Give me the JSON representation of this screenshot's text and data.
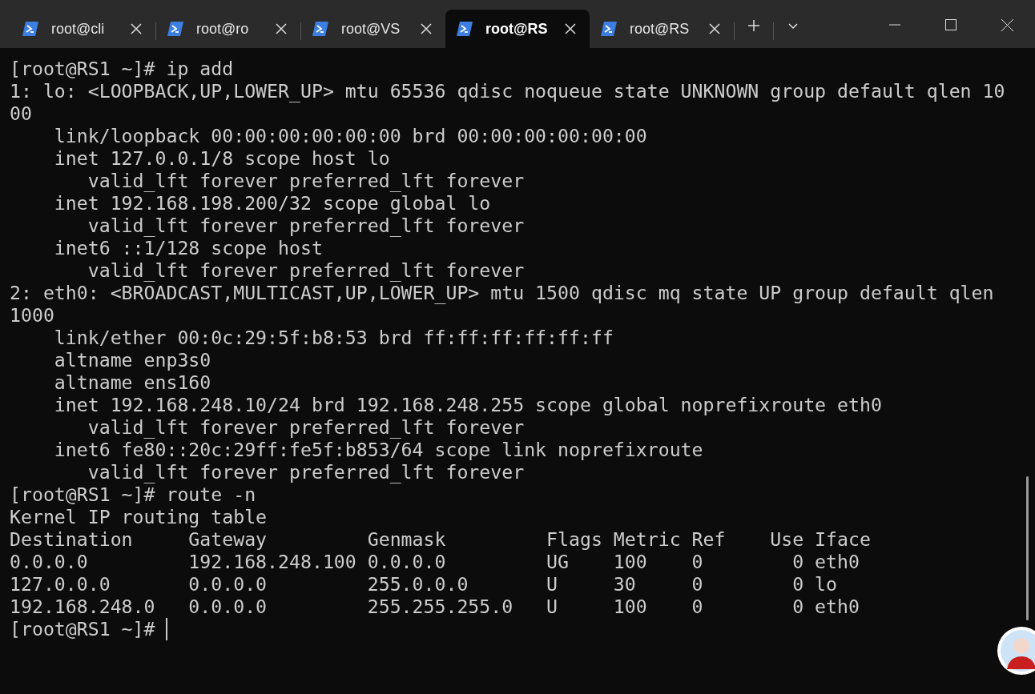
{
  "tabs": [
    {
      "label": "root@cli",
      "selected": false
    },
    {
      "label": "root@ro",
      "selected": false
    },
    {
      "label": "root@VS",
      "selected": false
    },
    {
      "label": "root@RS",
      "selected": true
    },
    {
      "label": "root@RS",
      "selected": false
    }
  ],
  "terminal": {
    "lines": [
      "[root@RS1 ~]# ip add",
      "1: lo: <LOOPBACK,UP,LOWER_UP> mtu 65536 qdisc noqueue state UNKNOWN group default qlen 10",
      "00",
      "    link/loopback 00:00:00:00:00:00 brd 00:00:00:00:00:00",
      "    inet 127.0.0.1/8 scope host lo",
      "       valid_lft forever preferred_lft forever",
      "    inet 192.168.198.200/32 scope global lo",
      "       valid_lft forever preferred_lft forever",
      "    inet6 ::1/128 scope host",
      "       valid_lft forever preferred_lft forever",
      "2: eth0: <BROADCAST,MULTICAST,UP,LOWER_UP> mtu 1500 qdisc mq state UP group default qlen",
      "1000",
      "    link/ether 00:0c:29:5f:b8:53 brd ff:ff:ff:ff:ff:ff",
      "    altname enp3s0",
      "    altname ens160",
      "    inet 192.168.248.10/24 brd 192.168.248.255 scope global noprefixroute eth0",
      "       valid_lft forever preferred_lft forever",
      "    inet6 fe80::20c:29ff:fe5f:b853/64 scope link noprefixroute",
      "       valid_lft forever preferred_lft forever",
      "[root@RS1 ~]# route -n",
      "Kernel IP routing table",
      "Destination     Gateway         Genmask         Flags Metric Ref    Use Iface",
      "0.0.0.0         192.168.248.100 0.0.0.0         UG    100    0        0 eth0",
      "127.0.0.0       0.0.0.0         255.0.0.0       U     30     0        0 lo",
      "192.168.248.0   0.0.0.0         255.255.255.0   U     100    0        0 eth0"
    ],
    "prompt": "[root@RS1 ~]#"
  }
}
